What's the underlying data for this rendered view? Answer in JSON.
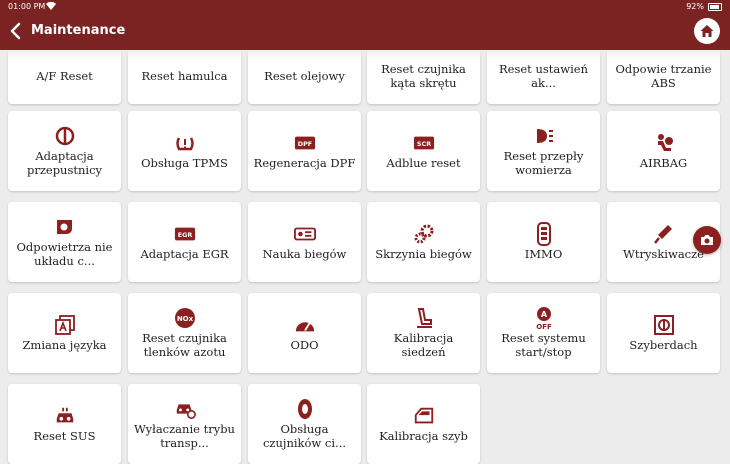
{
  "status": {
    "time": "01:00 PM",
    "battery": "92%"
  },
  "header": {
    "title": "Maintenance"
  },
  "colors": {
    "accent": "#7b2222",
    "icon": "#8b2020"
  },
  "tiles": [
    {
      "label": "A/F Reset",
      "icon": "af-icon"
    },
    {
      "label": "Reset hamulca",
      "icon": "brake-icon"
    },
    {
      "label": "Reset olejowy",
      "icon": "oil-icon"
    },
    {
      "label": "Reset czujnika kąta skrętu",
      "icon": "steering-icon"
    },
    {
      "label": "Reset ustawień ak...",
      "icon": "battery-icon"
    },
    {
      "label": "Odpowie trzanie ABS",
      "icon": "abs-icon"
    },
    {
      "label": "Adaptacja przepustnicy",
      "icon": "throttle-icon"
    },
    {
      "label": "Obsługa TPMS",
      "icon": "tpms-icon"
    },
    {
      "label": "Regeneracja DPF",
      "icon": "dpf-icon"
    },
    {
      "label": "Adblue reset",
      "icon": "scr-icon"
    },
    {
      "label": "Reset przepły womierza",
      "icon": "headlight-icon"
    },
    {
      "label": "AIRBAG",
      "icon": "airbag-icon"
    },
    {
      "label": "Odpowietrza nie układu c...",
      "icon": "cooling-icon"
    },
    {
      "label": "Adaptacja EGR",
      "icon": "egr-icon"
    },
    {
      "label": "Nauka biegów",
      "icon": "gear-learning-icon"
    },
    {
      "label": "Skrzynia biegów",
      "icon": "gearbox-icon"
    },
    {
      "label": "IMMO",
      "icon": "key-icon"
    },
    {
      "label": "Wtryskiwacze",
      "icon": "injector-icon"
    },
    {
      "label": "Zmiana języka",
      "icon": "language-icon"
    },
    {
      "label": "Reset czujnika tlenków azotu",
      "icon": "nox-icon"
    },
    {
      "label": "ODO",
      "icon": "odometer-icon"
    },
    {
      "label": "Kalibracja siedzeń",
      "icon": "seat-icon"
    },
    {
      "label": "Reset systemu start/stop",
      "icon": "start-stop-icon"
    },
    {
      "label": "Szyberdach",
      "icon": "sunroof-icon"
    },
    {
      "label": "Reset SUS",
      "icon": "suspension-icon"
    },
    {
      "label": "Wyłaczanie trybu transp...",
      "icon": "transport-icon"
    },
    {
      "label": "Obsługa czujników ci...",
      "icon": "tire-icon"
    },
    {
      "label": "Kalibracja szyb",
      "icon": "window-icon"
    }
  ],
  "icon_text": {
    "dpf": "DPF",
    "scr": "SCR",
    "egr": "EGR",
    "nox": "NOx",
    "off": "OFF"
  }
}
